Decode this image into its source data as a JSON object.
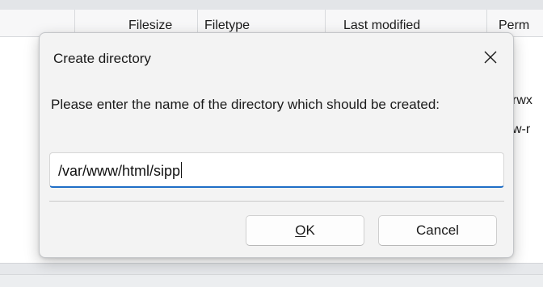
{
  "background": {
    "columns": [
      {
        "label": "Filesize"
      },
      {
        "label": "Filetype"
      },
      {
        "label": "Last modified"
      },
      {
        "label": "Perm"
      }
    ],
    "rows": [
      {
        "permissions": "rwx"
      },
      {
        "permissions": "w-r"
      }
    ]
  },
  "dialog": {
    "title": "Create directory",
    "close_icon": "close-icon",
    "prompt": "Please enter the name of the directory which should be created:",
    "input_value": "/var/www/html/sipp",
    "ok_label_mnemonic": "O",
    "ok_label_rest": "K",
    "cancel_label": "Cancel",
    "accent_color": "#1f6ec6"
  }
}
